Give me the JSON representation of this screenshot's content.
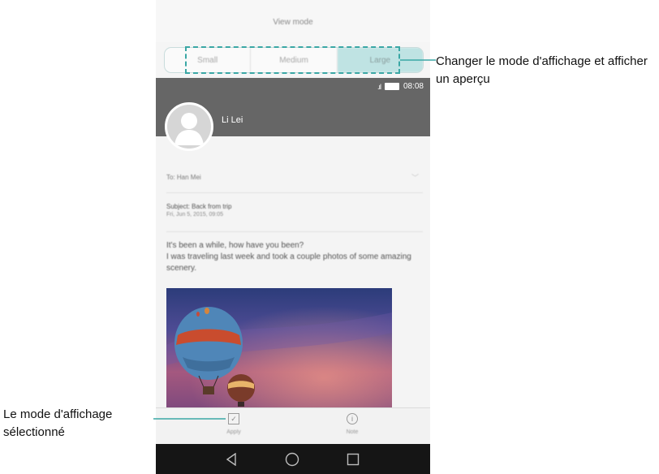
{
  "screen": {
    "title": "View mode",
    "segments": [
      {
        "label": "Small",
        "selected": false
      },
      {
        "label": "Medium",
        "selected": false
      },
      {
        "label": "Large",
        "selected": true
      }
    ]
  },
  "preview": {
    "status_time": "08:08",
    "sender": "Li Lei",
    "to": "To: Han Mei",
    "subject": "Subject: Back from trip",
    "date": "Fri, Jun 5, 2015, 09:05",
    "body_line1": "It's been a while, how have you been?",
    "body_line2": "I was traveling last week and took a couple photos of some amazing scenery."
  },
  "actions": {
    "apply": "Apply",
    "note": "Note"
  },
  "annotations": {
    "view_mode": "Changer le mode d'affichage et afficher un aperçu",
    "selected_mode_line1": "Le mode d'affichage",
    "selected_mode_line2": "sélectionné"
  },
  "colors": {
    "accent": "#3aa7a5",
    "selected_segment": "#bfe3e3",
    "mail_header": "#666666"
  },
  "icons": [
    "signal-icon",
    "battery-icon",
    "avatar-icon",
    "chevron-down-icon",
    "checkbox-icon",
    "info-icon",
    "back-icon",
    "home-icon",
    "recent-apps-icon"
  ]
}
